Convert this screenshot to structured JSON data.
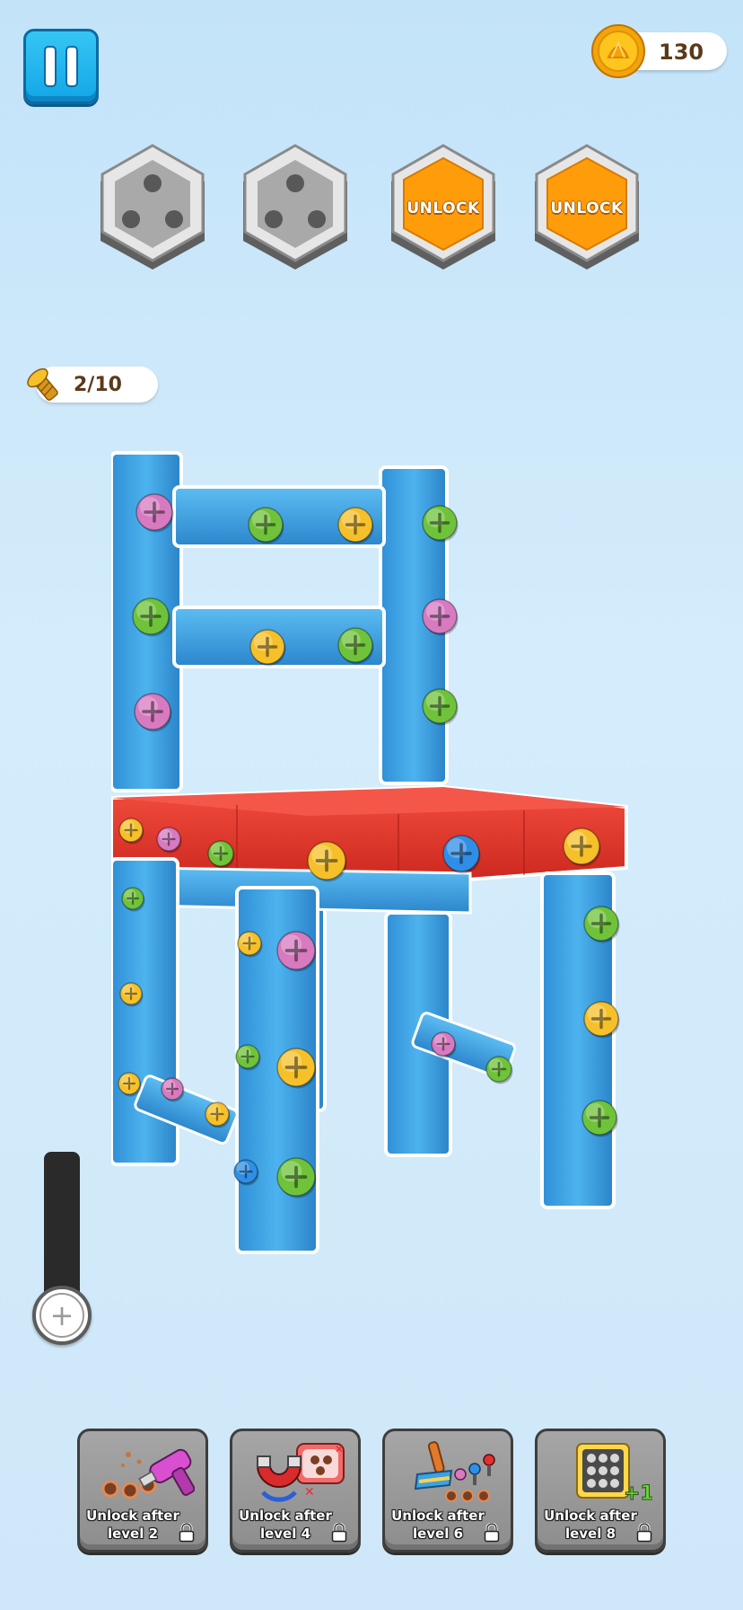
{
  "hud": {
    "coins": "130",
    "screws_progress": "2/10"
  },
  "slots": [
    {
      "state": "empty",
      "label": ""
    },
    {
      "state": "empty",
      "label": ""
    },
    {
      "state": "locked",
      "label": "UNLOCK"
    },
    {
      "state": "locked",
      "label": "UNLOCK"
    }
  ],
  "boosters": [
    {
      "name": "drill",
      "line1": "Unlock after",
      "line2": "level 2"
    },
    {
      "name": "magnet",
      "line1": "Unlock after",
      "line2": "level 4"
    },
    {
      "name": "broom",
      "line1": "Unlock after",
      "line2": "level 6"
    },
    {
      "name": "extra-slot",
      "line1": "Unlock after",
      "line2": "level 8"
    }
  ],
  "colors": {
    "board_blue": "#3aa3e3",
    "seat_red": "#e5342b",
    "screw_green": "#6fc33a",
    "screw_yellow": "#f5c02a",
    "screw_pink": "#d77ac0",
    "screw_blue": "#2f8fe6",
    "unlock_orange": "#ff9c0a"
  },
  "icons": {
    "pause": "pause-icon",
    "coin": "coin-icon",
    "screw": "screw-icon",
    "zoom": "zoom-slider-icon",
    "lock": "lock-icon"
  }
}
